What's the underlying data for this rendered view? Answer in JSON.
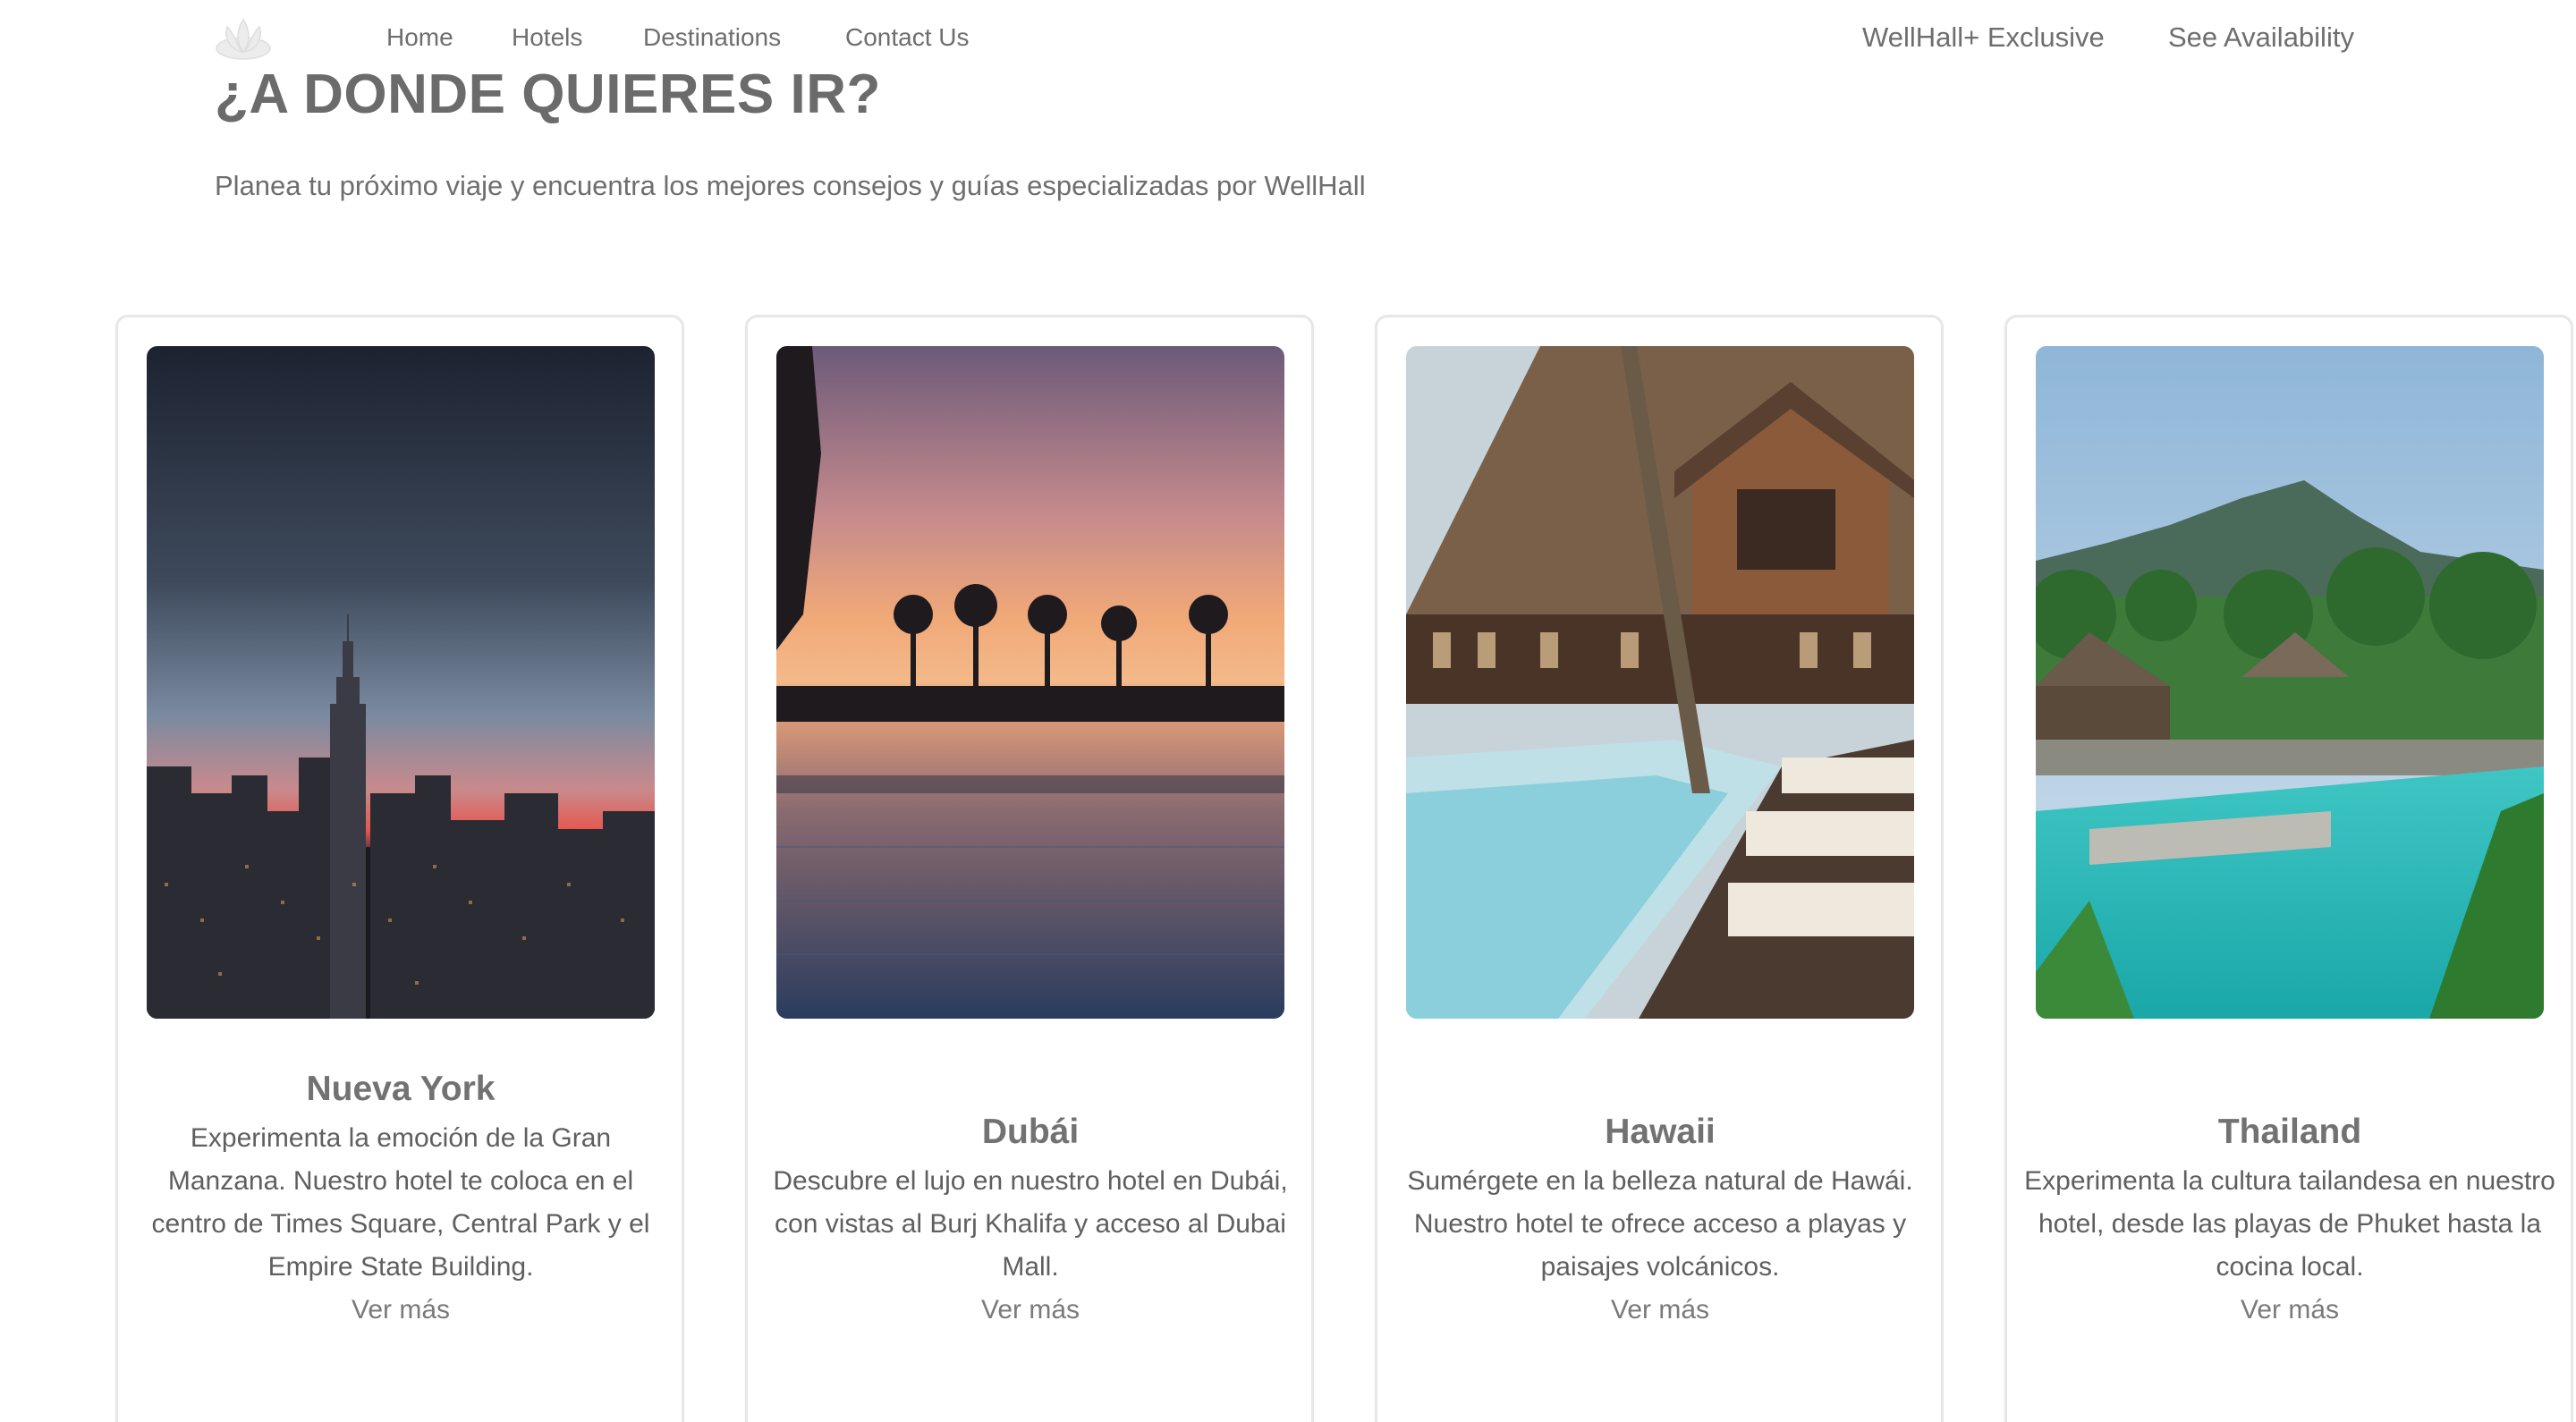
{
  "nav": {
    "logo_icon": "lotus-logo-icon",
    "links": [
      "Home",
      "Hotels",
      "Destinations",
      "Contact Us"
    ],
    "right_links": [
      "WellHall+ Exclusive",
      "See Availability"
    ]
  },
  "hero": {
    "title": "¿A DONDE QUIERES IR?",
    "subtitle": "Planea tu próximo viaje y encuentra los mejores consejos y guías especializadas por WellHall"
  },
  "cards": [
    {
      "title": "Nueva York",
      "text": "Experimenta la emoción de la Gran Manzana. Nuestro hotel te coloca en el centro de Times Square, Central Park y el Empire State Building.",
      "link": "Ver más",
      "image": "new-york-skyline-sunset-photo"
    },
    {
      "title": "Dubái",
      "text": "Descubre el lujo en nuestro hotel en Dubái, con vistas al Burj Khalifa y acceso al Dubai Mall.",
      "link": "Ver más",
      "image": "dubai-infinity-pool-sunset-photo"
    },
    {
      "title": "Hawaii",
      "text": "Sumérgete en la belleza natural de Hawái. Nuestro hotel te ofrece acceso a playas y paisajes volcánicos.",
      "link": "Ver más",
      "image": "hawaii-wooden-resort-pool-photo"
    },
    {
      "title": "Thailand",
      "text": "Experimenta la cultura tailandesa en nuestro hotel, desde las playas de Phuket hasta la cocina local.",
      "link": "Ver más",
      "image": "thailand-tropical-pool-photo"
    }
  ],
  "colors": {
    "text": "#6b6b6b",
    "card_border": "#e7e7ea",
    "background": "#ffffff"
  }
}
